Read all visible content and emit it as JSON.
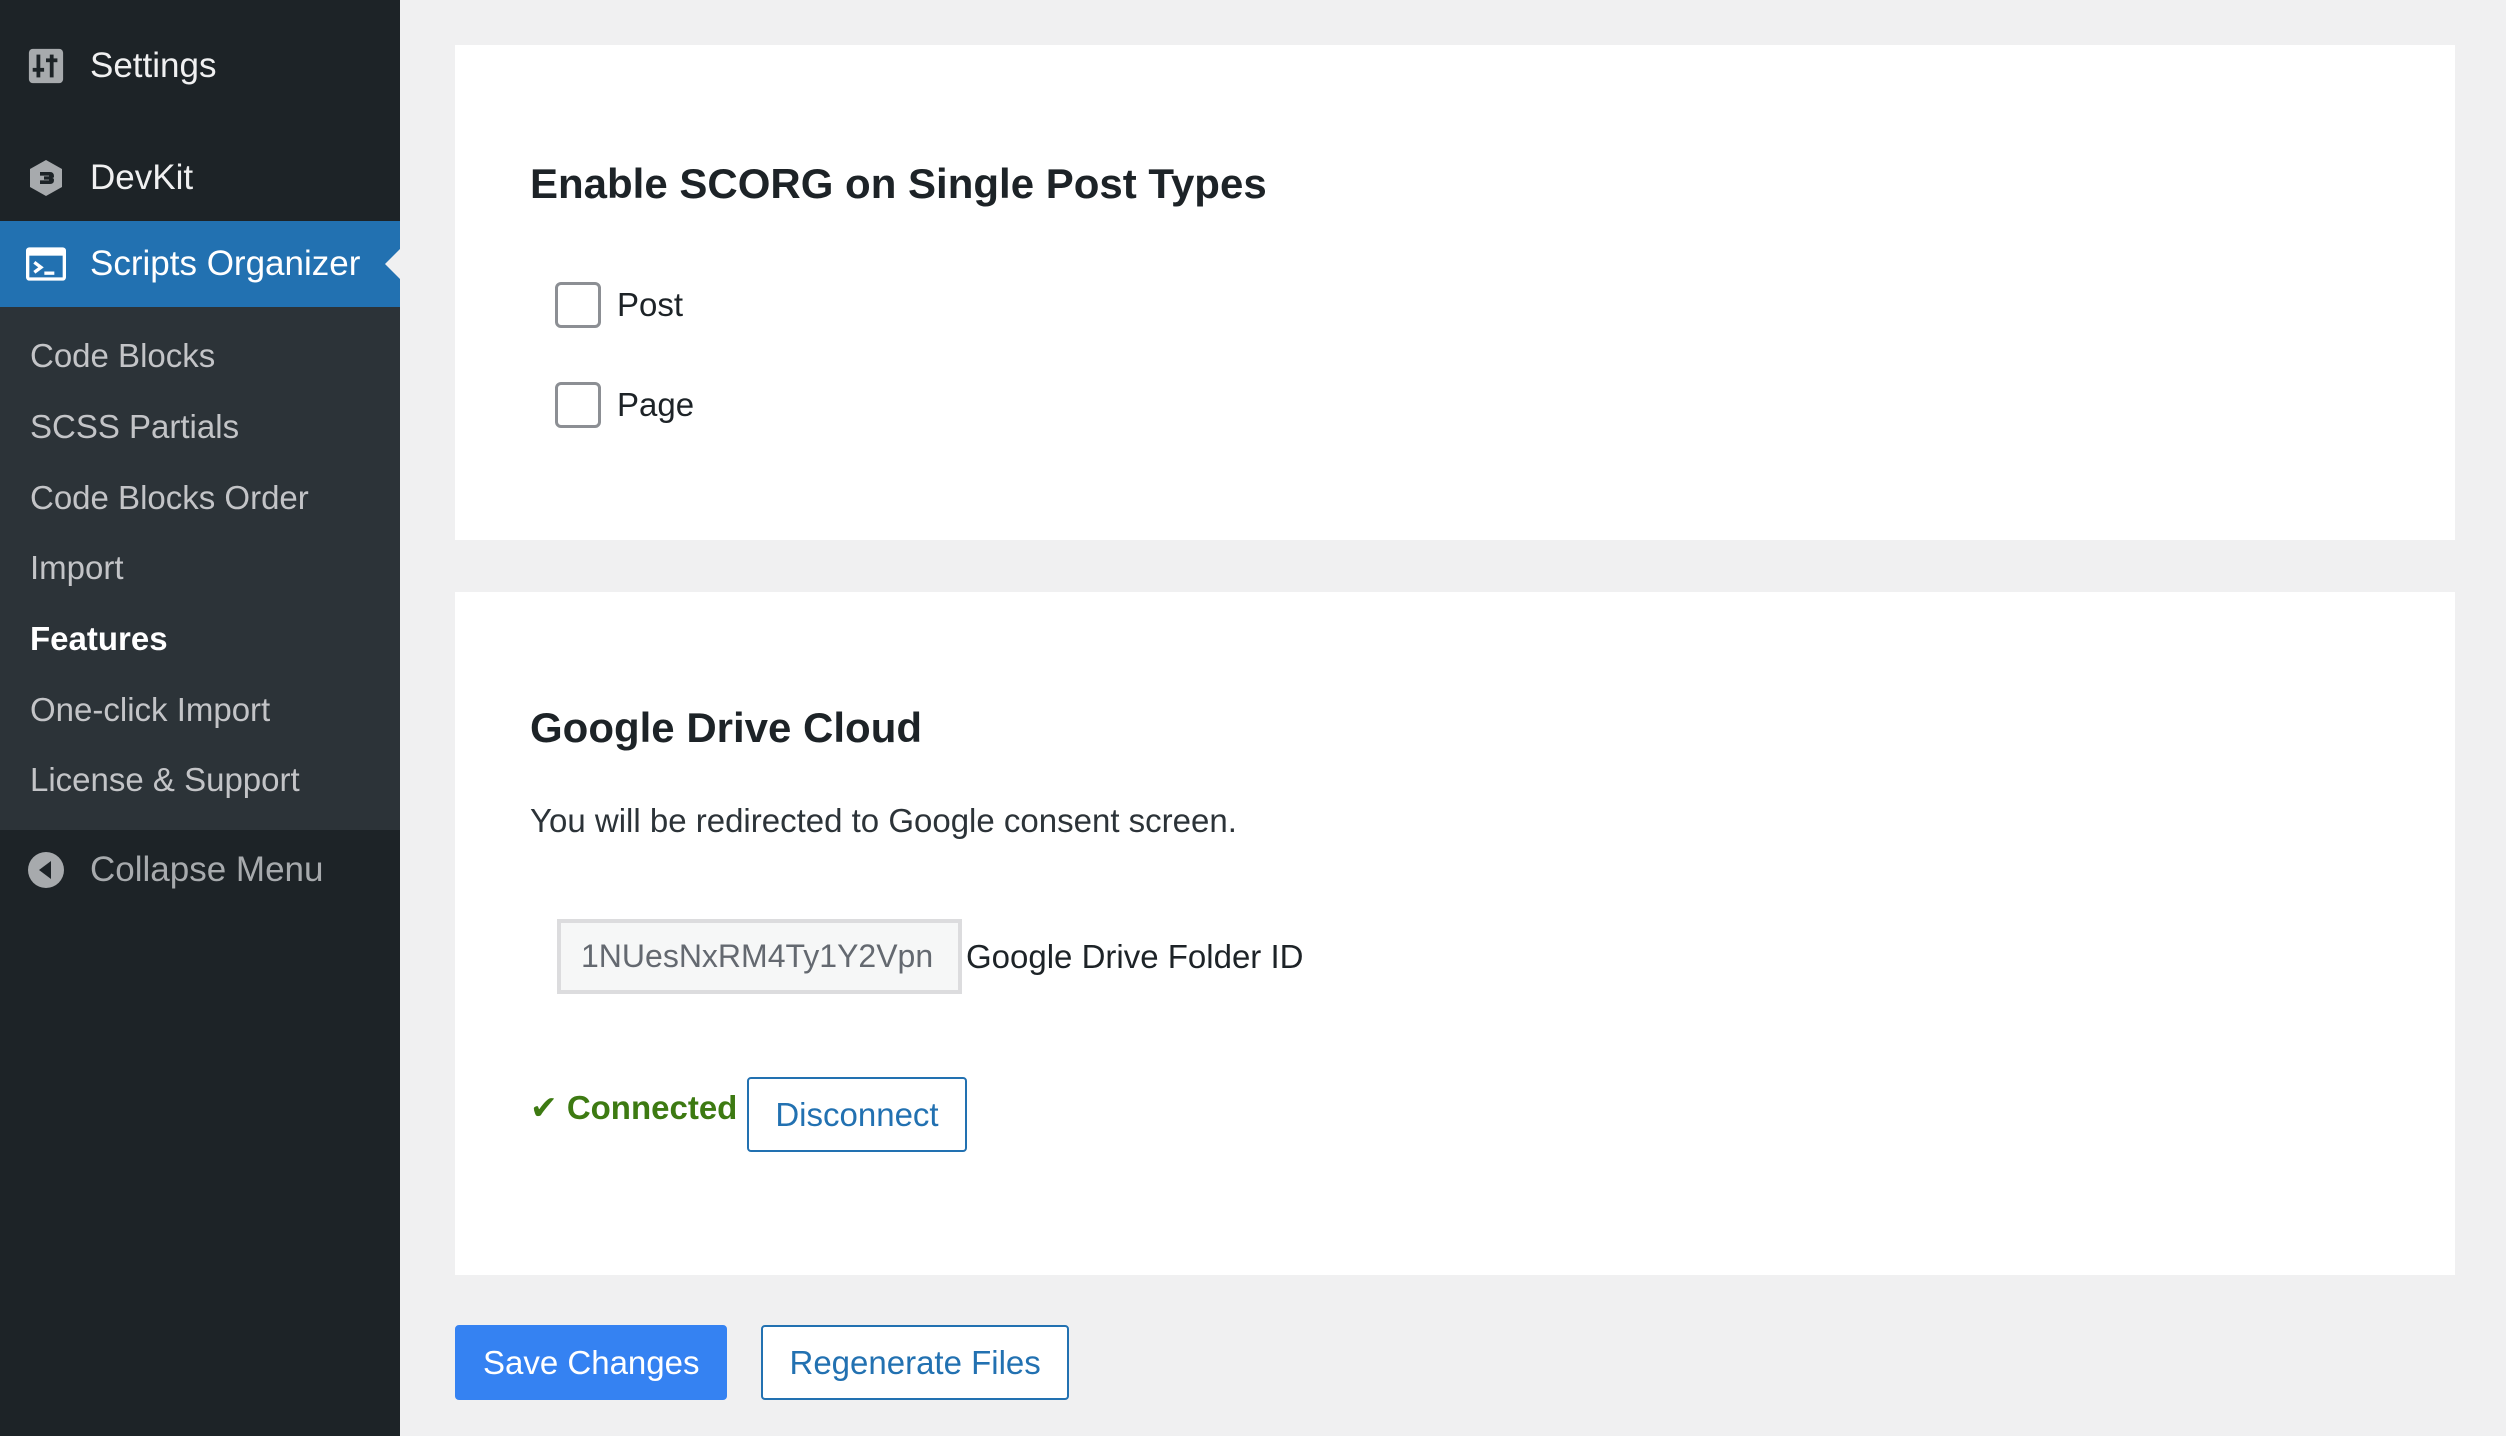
{
  "sidebar": {
    "settings_label": "Settings",
    "devkit_label": "DevKit",
    "scripts_label": "Scripts Organizer",
    "submenu": [
      "Code Blocks",
      "SCSS Partials",
      "Code Blocks Order",
      "Import",
      "Features",
      "One-click Import",
      "License & Support"
    ],
    "current_item": "Features",
    "collapse_label": "Collapse Menu"
  },
  "post_types": {
    "title": "Enable SCORG on Single Post Types",
    "options": [
      {
        "label": "Post",
        "checked": false
      },
      {
        "label": "Page",
        "checked": false
      }
    ]
  },
  "gdrive": {
    "title": "Google Drive Cloud",
    "description": "You will be redirected to Google consent screen.",
    "folder_id_value": "1NUesNxRM4Ty1Y2Vpn",
    "folder_id_label": "Google Drive Folder ID",
    "status_text": "✔ Connected",
    "disconnect_label": "Disconnect"
  },
  "actions": {
    "save_label": "Save Changes",
    "regenerate_label": "Regenerate Files"
  },
  "colors": {
    "sidebar_bg": "#1d2327",
    "submenu_bg": "#2c3338",
    "accent": "#2271b1",
    "primary_button": "#3582f2",
    "connected_green": "#3d7a12"
  }
}
